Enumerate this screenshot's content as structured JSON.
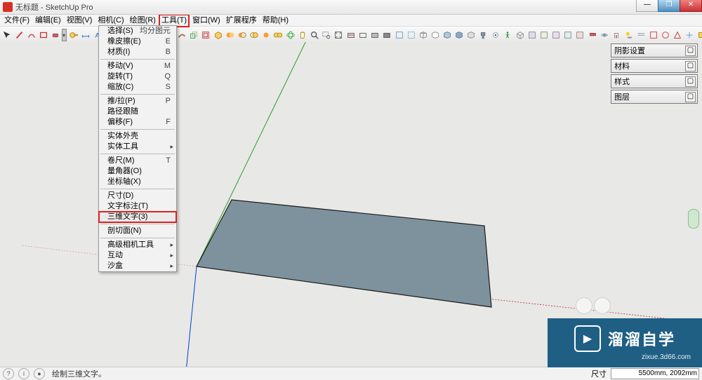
{
  "window": {
    "title": "无标题 - SketchUp Pro",
    "min": "—",
    "max": "❐",
    "close": "✕"
  },
  "menubar": [
    {
      "label": "文件(F)"
    },
    {
      "label": "编辑(E)"
    },
    {
      "label": "视图(V)"
    },
    {
      "label": "相机(C)"
    },
    {
      "label": "绘图(R)"
    },
    {
      "label": "工具(T)",
      "highlight": true
    },
    {
      "label": "窗口(W)"
    },
    {
      "label": "扩展程序"
    },
    {
      "label": "帮助(H)"
    }
  ],
  "dropdown": {
    "items": [
      {
        "label": "选择(S)",
        "sc": "均分图元"
      },
      {
        "label": "橡皮擦(E)",
        "sc": "E"
      },
      {
        "label": "材质(I)",
        "sc": "B"
      },
      {
        "sep": true
      },
      {
        "label": "移动(V)",
        "sc": "M"
      },
      {
        "label": "旋转(T)",
        "sc": "Q"
      },
      {
        "label": "缩放(C)",
        "sc": "S"
      },
      {
        "sep": true
      },
      {
        "label": "推/拉(P)",
        "sc": "P"
      },
      {
        "label": "路径跟随"
      },
      {
        "label": "偏移(F)",
        "sc": "F"
      },
      {
        "sep": true
      },
      {
        "label": "实体外壳"
      },
      {
        "label": "实体工具",
        "submenu": true
      },
      {
        "sep": true
      },
      {
        "label": "卷尺(M)",
        "sc": "T"
      },
      {
        "label": "量角器(O)"
      },
      {
        "label": "坐标轴(X)"
      },
      {
        "sep": true
      },
      {
        "label": "尺寸(D)"
      },
      {
        "label": "文字标注(T)"
      },
      {
        "label": "三维文字(3)",
        "highlight": true
      },
      {
        "sep": true
      },
      {
        "label": "剖切面(N)"
      },
      {
        "sep": true
      },
      {
        "label": "高级相机工具",
        "submenu": true
      },
      {
        "label": "互动",
        "submenu": true
      },
      {
        "label": "沙盒",
        "submenu": true
      }
    ]
  },
  "panels": [
    {
      "title": "阴影设置",
      "btn": "▢"
    },
    {
      "title": "材料",
      "btn": "▢"
    },
    {
      "title": "样式",
      "btn": "▢"
    },
    {
      "title": "图层",
      "btn": "▢"
    }
  ],
  "statusbar": {
    "message": "绘制三维文字。",
    "dim_label": "尺寸",
    "dim_value": "5500mm, 2092mm"
  },
  "watermark": {
    "text": "溜溜自学",
    "sub": "zixue.3d66.com",
    "icon": "▶"
  },
  "icons": {
    "pointer": "pointer",
    "pencil": "pencil",
    "eraser": "eraser",
    "paint": "paint",
    "rect": "rect",
    "tape": "tape",
    "text": "text",
    "move": "move",
    "rotate": "rotate",
    "scale": "scale",
    "push": "push",
    "orbit": "orbit",
    "pan": "pan",
    "zoom": "zoom",
    "extents": "extents"
  }
}
